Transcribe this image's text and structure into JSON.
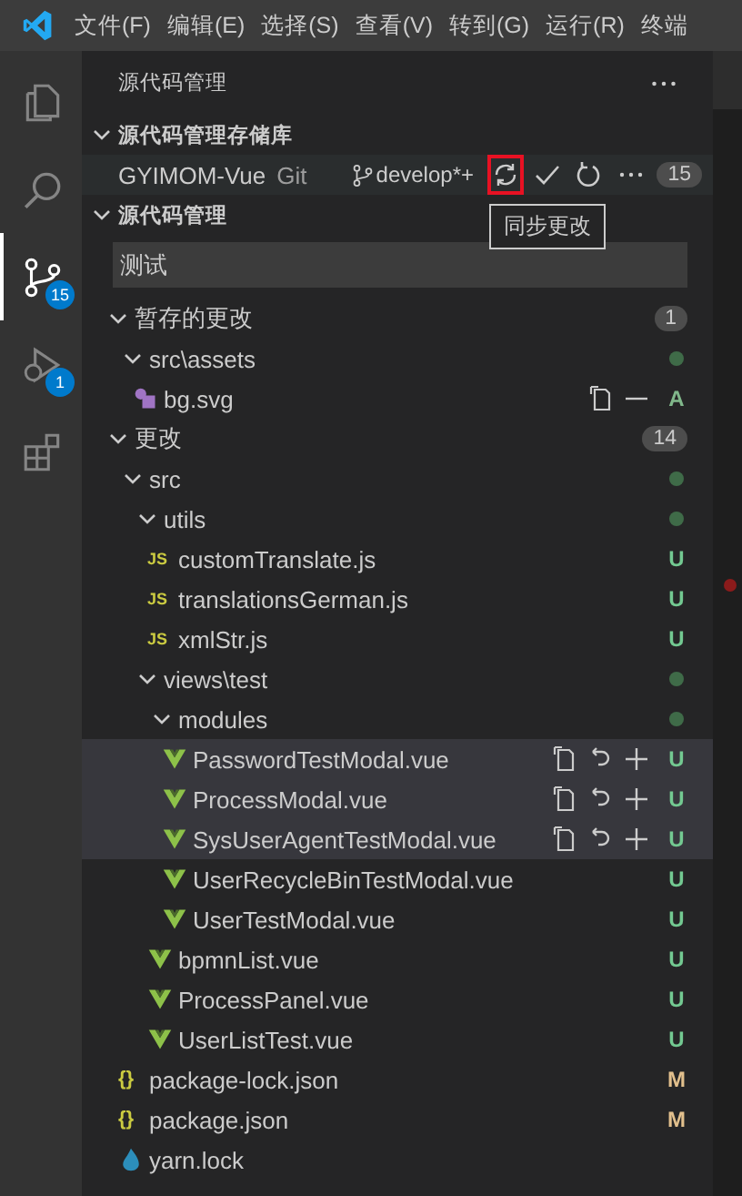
{
  "menu": [
    "文件(F)",
    "编辑(E)",
    "选择(S)",
    "查看(V)",
    "转到(G)",
    "运行(R)",
    "终端"
  ],
  "activity_bar": [
    {
      "kind": "files",
      "selected": false
    },
    {
      "kind": "search",
      "selected": false
    },
    {
      "kind": "scm",
      "selected": true,
      "badge": "15"
    },
    {
      "kind": "debug",
      "selected": false,
      "badge": "1"
    },
    {
      "kind": "extensions",
      "selected": false
    }
  ],
  "sidebar": {
    "title": "源代码管理"
  },
  "repositories": {
    "header": "源代码管理存储库",
    "expanded": true,
    "repo": {
      "name": "GYIMOM-Vue",
      "provider": "Git",
      "branch": "develop*+",
      "count": "15",
      "actions": [
        {
          "kind": "sync",
          "highlighted": true
        },
        {
          "kind": "commit",
          "highlighted": false
        },
        {
          "kind": "refresh",
          "highlighted": false
        },
        {
          "kind": "more",
          "highlighted": false
        }
      ]
    }
  },
  "tooltip": "同步更改",
  "changes": {
    "header": "源代码管理",
    "expanded": true,
    "message": "测试",
    "groups": [
      {
        "kind": "group",
        "label": "暂存的更改",
        "count": "1",
        "expanded": true,
        "children": [
          {
            "kind": "folder",
            "label": "src\\assets",
            "expanded": true,
            "color": "#3f6b48",
            "children": [
              {
                "kind": "svg-file",
                "label": "bg.svg",
                "selected": false,
                "status": "A",
                "color": "#81b88b",
                "actions": [
                  {
                    "kind": "open"
                  },
                  {
                    "kind": "unstage"
                  }
                ]
              }
            ]
          }
        ]
      },
      {
        "kind": "group",
        "label": "更改",
        "count": "14",
        "expanded": true,
        "children": [
          {
            "kind": "folder",
            "label": "src",
            "expanded": true,
            "color": "#3f6b48",
            "children": [
              {
                "kind": "folder",
                "label": "utils",
                "expanded": true,
                "color": "#3f6b48",
                "children": [
                  {
                    "kind": "js-file",
                    "label": "customTranslate.js",
                    "icon_label": "JS",
                    "selected": false,
                    "status": "U",
                    "color": "#73c991"
                  },
                  {
                    "kind": "js-file",
                    "label": "translationsGerman.js",
                    "icon_label": "JS",
                    "selected": false,
                    "status": "U",
                    "color": "#73c991"
                  },
                  {
                    "kind": "js-file",
                    "label": "xmlStr.js",
                    "icon_label": "JS",
                    "selected": false,
                    "status": "U",
                    "color": "#73c991"
                  }
                ]
              },
              {
                "kind": "folder",
                "label": "views\\test",
                "expanded": true,
                "color": "#3f6b48",
                "children": [
                  {
                    "kind": "folder",
                    "label": "modules",
                    "expanded": true,
                    "color": "#3f6b48",
                    "children": [
                      {
                        "kind": "vue-file",
                        "label": "PasswordTestModal.vue",
                        "selected": true,
                        "status": "U",
                        "color": "#73c991",
                        "actions": [
                          {
                            "kind": "open"
                          },
                          {
                            "kind": "discard"
                          },
                          {
                            "kind": "stage"
                          }
                        ]
                      },
                      {
                        "kind": "vue-file",
                        "label": "ProcessModal.vue",
                        "selected": true,
                        "status": "U",
                        "color": "#73c991",
                        "actions": [
                          {
                            "kind": "open"
                          },
                          {
                            "kind": "discard"
                          },
                          {
                            "kind": "stage"
                          }
                        ]
                      },
                      {
                        "kind": "vue-file",
                        "label": "SysUserAgentTestModal.vue",
                        "selected": true,
                        "status": "U",
                        "color": "#73c991",
                        "actions": [
                          {
                            "kind": "open"
                          },
                          {
                            "kind": "discard"
                          },
                          {
                            "kind": "stage"
                          }
                        ]
                      },
                      {
                        "kind": "vue-file",
                        "label": "UserRecycleBinTestModal.vue",
                        "selected": false,
                        "status": "U",
                        "color": "#73c991"
                      },
                      {
                        "kind": "vue-file",
                        "label": "UserTestModal.vue",
                        "selected": false,
                        "status": "U",
                        "color": "#73c991"
                      }
                    ]
                  },
                  {
                    "kind": "vue-file",
                    "label": "bpmnList.vue",
                    "selected": false,
                    "status": "U",
                    "color": "#73c991"
                  },
                  {
                    "kind": "vue-file",
                    "label": "ProcessPanel.vue",
                    "selected": false,
                    "status": "U",
                    "color": "#73c991"
                  },
                  {
                    "kind": "vue-file",
                    "label": "UserListTest.vue",
                    "selected": false,
                    "status": "U",
                    "color": "#73c991"
                  }
                ]
              }
            ]
          },
          {
            "kind": "json-file",
            "label": "package-lock.json",
            "icon_label": "{}",
            "selected": false,
            "status": "M",
            "color": "#e2c08d"
          },
          {
            "kind": "json-file",
            "label": "package.json",
            "icon_label": "{}",
            "selected": false,
            "status": "M",
            "color": "#e2c08d"
          },
          {
            "kind": "yarn-file",
            "label": "yarn.lock",
            "selected": false
          }
        ]
      }
    ]
  }
}
